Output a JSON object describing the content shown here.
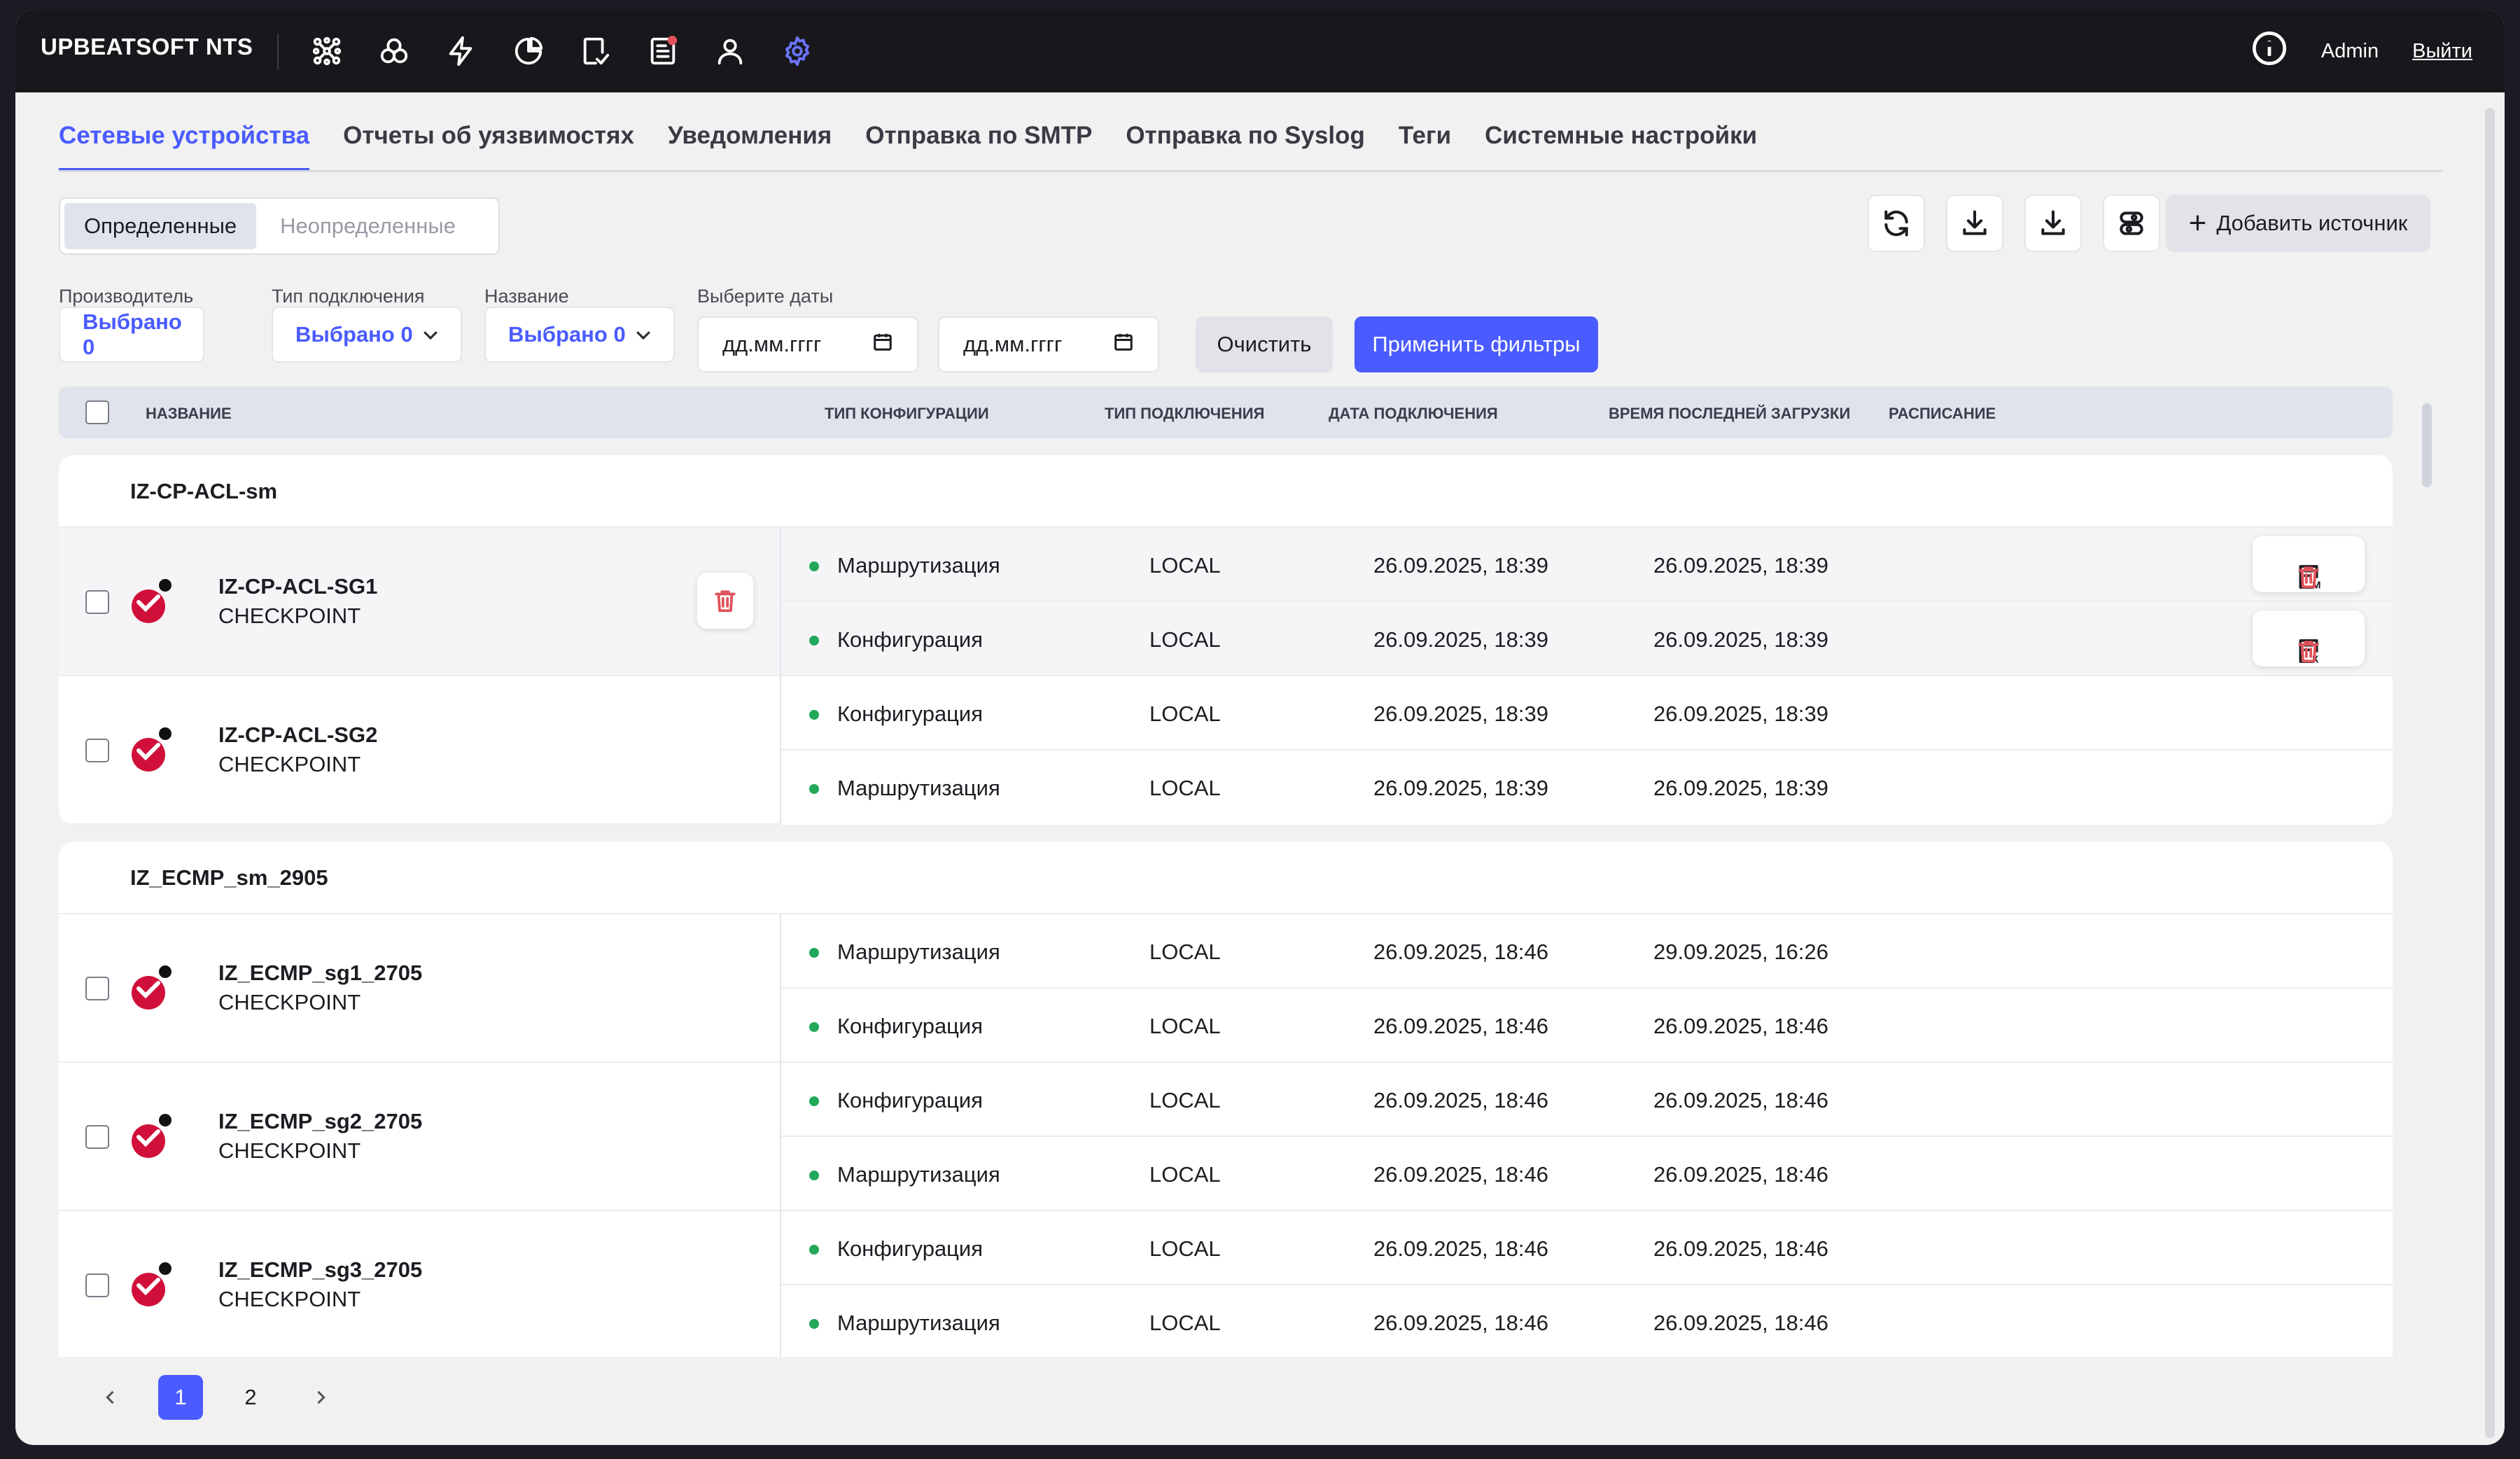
{
  "app": {
    "brand": "UPBEATSOFT NTS",
    "user": "Admin",
    "logout": "Выйти"
  },
  "nav_icons": [
    "network-icon",
    "cluster-icon",
    "lightning-icon",
    "pie-chart-icon",
    "document-check-icon",
    "report-icon",
    "user-icon",
    "settings-icon"
  ],
  "tabs": [
    "Сетевые устройства",
    "Отчеты об уязвимостях",
    "Уведомления",
    "Отправка по SMTP",
    "Отправка по Syslog",
    "Теги",
    "Системные настройки"
  ],
  "segment": {
    "defined": "Определенные",
    "undefined": "Неопределенные"
  },
  "toolbar": {
    "add_source": "Добавить источник"
  },
  "filters": {
    "vendor_label": "Производитель",
    "vendor_value": "Выбрано 0",
    "conn_label": "Тип подключения",
    "conn_value": "Выбрано 0",
    "name_label": "Название",
    "name_value": "Выбрано 0",
    "dates_label": "Выберите даты",
    "date_placeholder": "дд.мм.гггг",
    "date_sep": "-",
    "clear": "Очистить",
    "apply": "Применить фильтры"
  },
  "columns": [
    "Название",
    "Тип конфигурации",
    "Тип подключения",
    "Дата подключения",
    "Время последней загрузки",
    "Расписание"
  ],
  "groups": [
    {
      "name": "IZ-CP-ACL-sm",
      "devices": [
        {
          "name": "IZ-CP-ACL-SG1",
          "vendor": "CHECKPOINT",
          "configs": [
            {
              "type": "Маршрутизация",
              "conn": "LOCAL",
              "date": "26.09.2025, 18:39",
              "last": "26.09.2025, 18:39"
            },
            {
              "type": "Конфигурация",
              "conn": "LOCAL",
              "date": "26.09.2025, 18:39",
              "last": "26.09.2025, 18:39"
            }
          ]
        },
        {
          "name": "IZ-CP-ACL-SG2",
          "vendor": "CHECKPOINT",
          "configs": [
            {
              "type": "Конфигурация",
              "conn": "LOCAL",
              "date": "26.09.2025, 18:39",
              "last": "26.09.2025, 18:39"
            },
            {
              "type": "Маршрутизация",
              "conn": "LOCAL",
              "date": "26.09.2025, 18:39",
              "last": "26.09.2025, 18:39"
            }
          ]
        }
      ]
    },
    {
      "name": "IZ_ECMP_sm_2905",
      "devices": [
        {
          "name": "IZ_ECMP_sg1_2705",
          "vendor": "CHECKPOINT",
          "configs": [
            {
              "type": "Маршрутизация",
              "conn": "LOCAL",
              "date": "26.09.2025, 18:46",
              "last": "29.09.2025, 16:26"
            },
            {
              "type": "Конфигурация",
              "conn": "LOCAL",
              "date": "26.09.2025, 18:46",
              "last": "26.09.2025, 18:46"
            }
          ]
        },
        {
          "name": "IZ_ECMP_sg2_2705",
          "vendor": "CHECKPOINT",
          "configs": [
            {
              "type": "Конфигурация",
              "conn": "LOCAL",
              "date": "26.09.2025, 18:46",
              "last": "26.09.2025, 18:46"
            },
            {
              "type": "Маршрутизация",
              "conn": "LOCAL",
              "date": "26.09.2025, 18:46",
              "last": "26.09.2025, 18:46"
            }
          ]
        },
        {
          "name": "IZ_ECMP_sg3_2705",
          "vendor": "CHECKPOINT",
          "configs": [
            {
              "type": "Конфигурация",
              "conn": "LOCAL",
              "date": "26.09.2025, 18:46",
              "last": "26.09.2025, 18:46"
            },
            {
              "type": "Маршрутизация",
              "conn": "LOCAL",
              "date": "26.09.2025, 18:46",
              "last": "26.09.2025, 18:46"
            }
          ]
        }
      ]
    }
  ],
  "row_action_letters": [
    "М",
    "К"
  ],
  "pagination": {
    "pages": [
      "1",
      "2"
    ],
    "current": "1"
  },
  "colors": {
    "accent": "#4a5bff",
    "status_ok": "#22a85a",
    "danger": "#e0525a",
    "brand_logo": "#d0103a"
  }
}
